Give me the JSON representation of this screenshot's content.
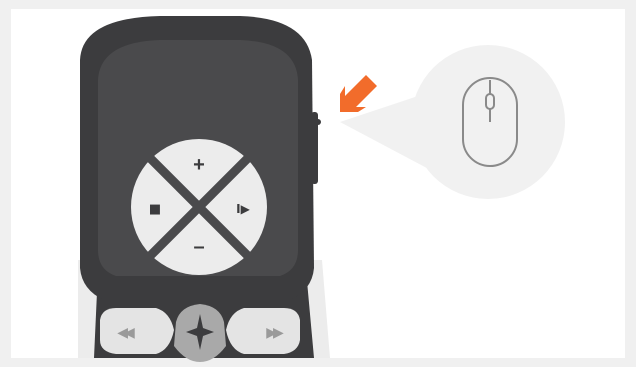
{
  "illustration": {
    "subject": "remote-control-with-side-mouse-button",
    "colors": {
      "background": "#f0f0f0",
      "panel": "#ffffff",
      "remote_body": "#3c3c3e",
      "remote_face": "#4a4a4c",
      "remote_edge": "#e4e4e4",
      "dpad": "#ececec",
      "glyph": "#3c3c3e",
      "arrow": "#f26c2b",
      "bubble": "#f1f1f1",
      "mouse_stroke": "#8a8a8a"
    },
    "icons": {
      "dpad_top": "plus-icon",
      "dpad_bottom": "minus-icon",
      "dpad_left": "stop-icon",
      "dpad_right": "play-pause-icon",
      "bottom_left": "rewind-icon",
      "bottom_center": "compass-star-icon",
      "bottom_right": "fast-forward-icon",
      "callout": "mouse-icon",
      "pointer": "arrow-icon"
    },
    "glyphs": {
      "plus": "+",
      "minus": "–",
      "stop": "■",
      "play_pause": "I▶",
      "rewind": "◀◀",
      "fast_forward": "▶▶"
    }
  }
}
